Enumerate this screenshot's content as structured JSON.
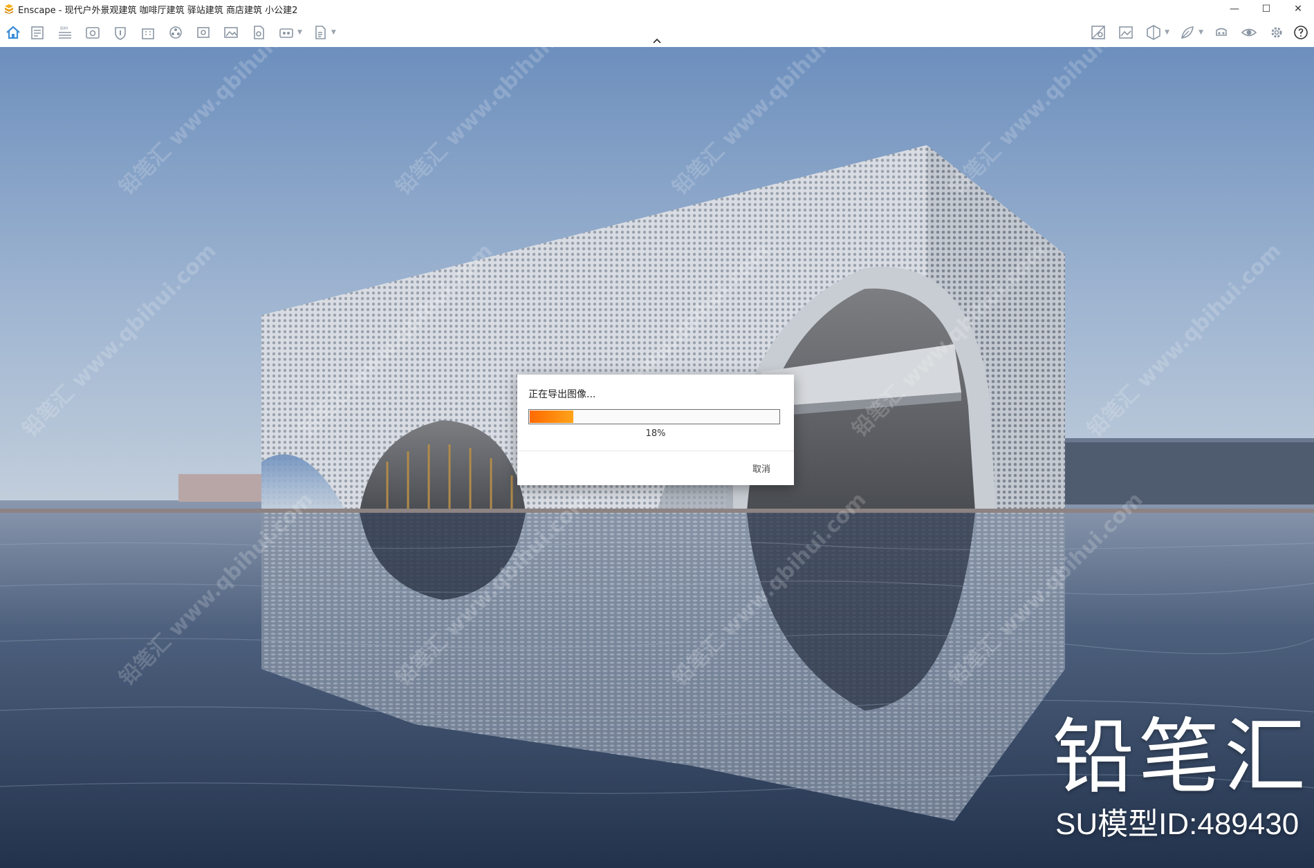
{
  "window": {
    "app_name": "Enscape",
    "title": "Enscape - 现代户外景观建筑 咖啡厅建筑 驿站建筑 商店建筑 小公建2",
    "controls": {
      "minimize": "—",
      "maximize": "☐",
      "close": "✕"
    }
  },
  "toolbar": {
    "left_icons": [
      "home-icon",
      "notes-icon",
      "bim-icon",
      "view-icon",
      "visual-settings-icon",
      "sun-icon",
      "building-icon",
      "batch-render-icon",
      "panorama-icon",
      "screenshot-icon",
      "export-icon",
      "render-360-icon",
      "export-exe-icon"
    ],
    "bim_label": "BIM",
    "right_icons": [
      "material-editor-icon",
      "image-icon",
      "section-icon",
      "asset-library-icon",
      "vr-headset-icon",
      "visibility-icon",
      "settings-icon",
      "help-icon"
    ]
  },
  "dialog": {
    "title": "正在导出图像...",
    "progress": 18,
    "progress_label": "18%",
    "cancel": "取消"
  },
  "watermark": {
    "text": "铅笔汇 www.qbihui.com",
    "brand": "铅笔汇",
    "model_id": "SU模型ID:489430"
  },
  "colors": {
    "accent": "#ff6a00",
    "toolbar_icon": "#8a96a3",
    "home_icon": "#3b8ed8"
  }
}
